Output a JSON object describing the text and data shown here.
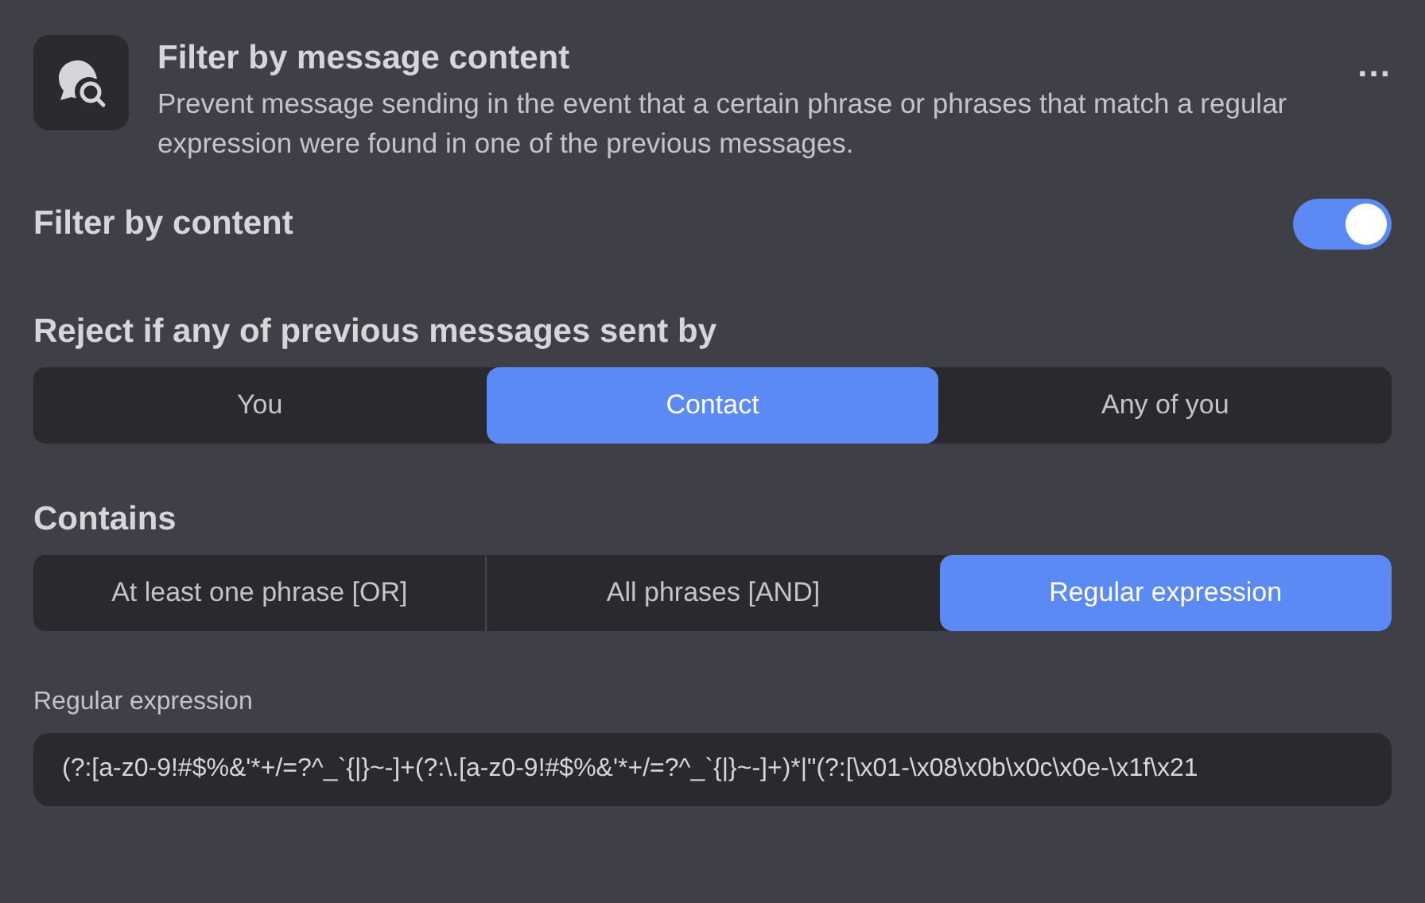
{
  "header": {
    "title": "Filter by message content",
    "description": "Prevent message sending in the event that a certain phrase or phrases that match a regular expression were found in one of the previous messages.",
    "menu": "..."
  },
  "filter_toggle": {
    "label": "Filter by content",
    "on": true
  },
  "sender_group": {
    "label": "Reject if any of previous messages sent by",
    "options": [
      {
        "label": "You",
        "selected": false
      },
      {
        "label": "Contact",
        "selected": true
      },
      {
        "label": "Any of you",
        "selected": false
      }
    ]
  },
  "contains_group": {
    "label": "Contains",
    "options": [
      {
        "label": "At least one phrase [OR]",
        "selected": false
      },
      {
        "label": "All phrases [AND]",
        "selected": false
      },
      {
        "label": "Regular expression",
        "selected": true
      }
    ]
  },
  "regex_field": {
    "label": "Regular expression",
    "value": "(?:[a-z0-9!#$%&'*+/=?^_`{|}~-]+(?:\\.[a-z0-9!#$%&'*+/=?^_`{|}~-]+)*|\"(?:[\\x01-\\x08\\x0b\\x0c\\x0e-\\x1f\\x21"
  }
}
